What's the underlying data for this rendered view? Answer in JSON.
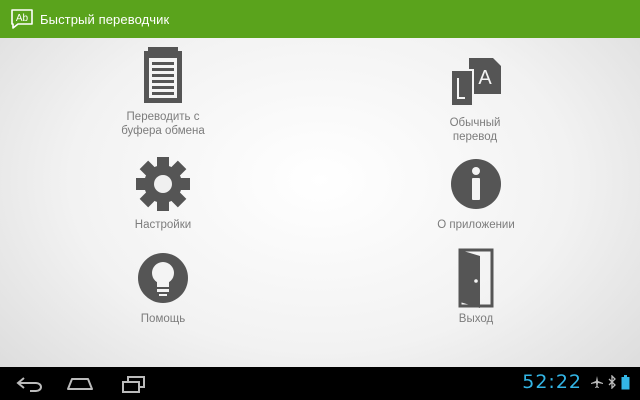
{
  "app": {
    "title": "Быстрый переводчик",
    "logo_text": "Ab",
    "accent_color": "#5aa31c"
  },
  "menu": {
    "clipboard": {
      "label": "Переводить с\nбуфера обмена",
      "icon": "clipboard-icon"
    },
    "translate": {
      "label": "Обычный\nперевод",
      "icon": "translate-icon"
    },
    "settings": {
      "label": "Настройки",
      "icon": "gear-icon"
    },
    "about": {
      "label": "О приложении",
      "icon": "info-icon"
    },
    "help": {
      "label": "Помощь",
      "icon": "lightbulb-icon"
    },
    "exit": {
      "label": "Выход",
      "icon": "door-icon"
    }
  },
  "system_bar": {
    "clock": "52:22",
    "clock_color": "#33b5e5",
    "icons": [
      "back-icon",
      "home-icon",
      "recent-apps-icon",
      "airplane-icon",
      "bluetooth-icon",
      "battery-icon"
    ]
  }
}
